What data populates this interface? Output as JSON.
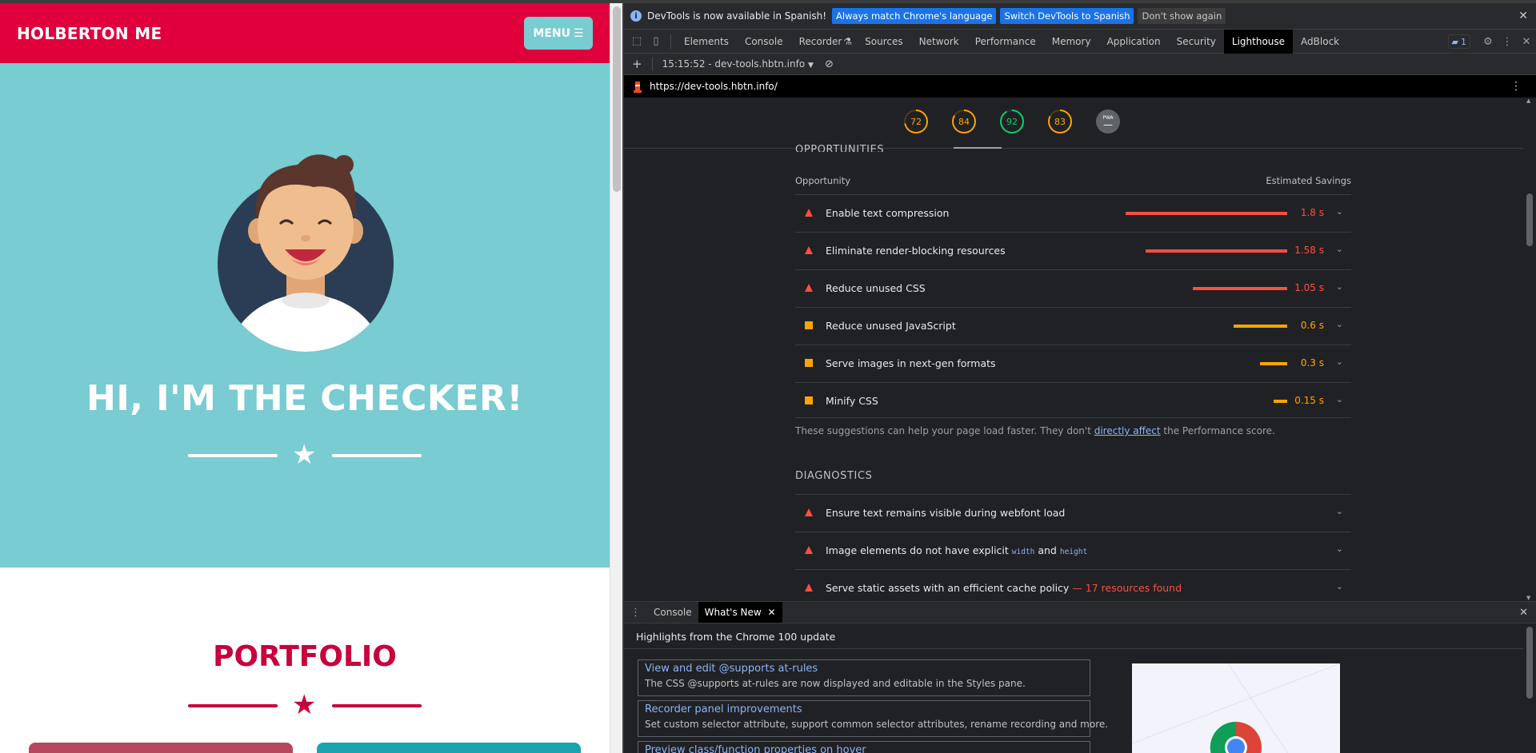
{
  "page": {
    "brand": "HOLBERTON ME",
    "menu_label": "MENU",
    "hero_title": "HI, I'M THE CHECKER!",
    "portfolio_title": "PORTFOLIO",
    "colors": {
      "brand_red": "#e0003c",
      "teal": "#79ccd1"
    }
  },
  "devtools": {
    "infobar": {
      "message": "DevTools is now available in Spanish!",
      "btn_match": "Always match Chrome's language",
      "btn_switch": "Switch DevTools to Spanish",
      "btn_dismiss": "Don't show again"
    },
    "tabs": [
      "Elements",
      "Console",
      "Recorder",
      "Sources",
      "Network",
      "Performance",
      "Memory",
      "Application",
      "Security",
      "Lighthouse",
      "AdBlock"
    ],
    "active_tab": "Lighthouse",
    "issues_count": "1",
    "report_selector": "15:15:52 - dev-tools.hbtn.info",
    "url": "https://dev-tools.hbtn.info/",
    "scores": [
      {
        "value": "72",
        "color": "#ffa400"
      },
      {
        "value": "84",
        "color": "#ffa400"
      },
      {
        "value": "92",
        "color": "#0cce6b"
      },
      {
        "value": "83",
        "color": "#ffa400"
      },
      {
        "value": "PWA",
        "color": "#9aa0a6"
      }
    ],
    "opportunities": {
      "section_title": "OPPORTUNITIES",
      "col_opportunity": "Opportunity",
      "col_savings": "Estimated Savings",
      "items": [
        {
          "label": "Enable text compression",
          "savings": "1.8 s",
          "seconds": 1.8,
          "severity": "fail"
        },
        {
          "label": "Eliminate render-blocking resources",
          "savings": "1.58 s",
          "seconds": 1.58,
          "severity": "fail"
        },
        {
          "label": "Reduce unused CSS",
          "savings": "1.05 s",
          "seconds": 1.05,
          "severity": "fail"
        },
        {
          "label": "Reduce unused JavaScript",
          "savings": "0.6 s",
          "seconds": 0.6,
          "severity": "average"
        },
        {
          "label": "Serve images in next-gen formats",
          "savings": "0.3 s",
          "seconds": 0.3,
          "severity": "average"
        },
        {
          "label": "Minify CSS",
          "savings": "0.15 s",
          "seconds": 0.15,
          "severity": "average"
        }
      ],
      "note_before": "These suggestions can help your page load faster. They don't ",
      "note_link": "directly affect",
      "note_after": " the Performance score."
    },
    "diagnostics": {
      "section_title": "DIAGNOSTICS",
      "items": [
        {
          "label": "Ensure text remains visible during webfont load"
        },
        {
          "label_prefix": "Image elements do not have explicit ",
          "code1": "width",
          "mid": " and ",
          "code2": "height"
        },
        {
          "label": "Serve static assets with an efficient cache policy",
          "extra": " — 17 resources found"
        }
      ]
    },
    "drawer": {
      "tabs": [
        "Console",
        "What's New"
      ],
      "active_tab": "What's New",
      "heading": "Highlights from the Chrome 100 update",
      "cards": [
        {
          "title": "View and edit @supports at-rules",
          "desc": "The CSS @supports at-rules are now displayed and editable in the Styles pane."
        },
        {
          "title": "Recorder panel improvements",
          "desc": "Set custom selector attribute, support common selector attributes, rename recording and more."
        },
        {
          "title": "Preview class/function properties on hover",
          "desc": ""
        }
      ]
    }
  }
}
